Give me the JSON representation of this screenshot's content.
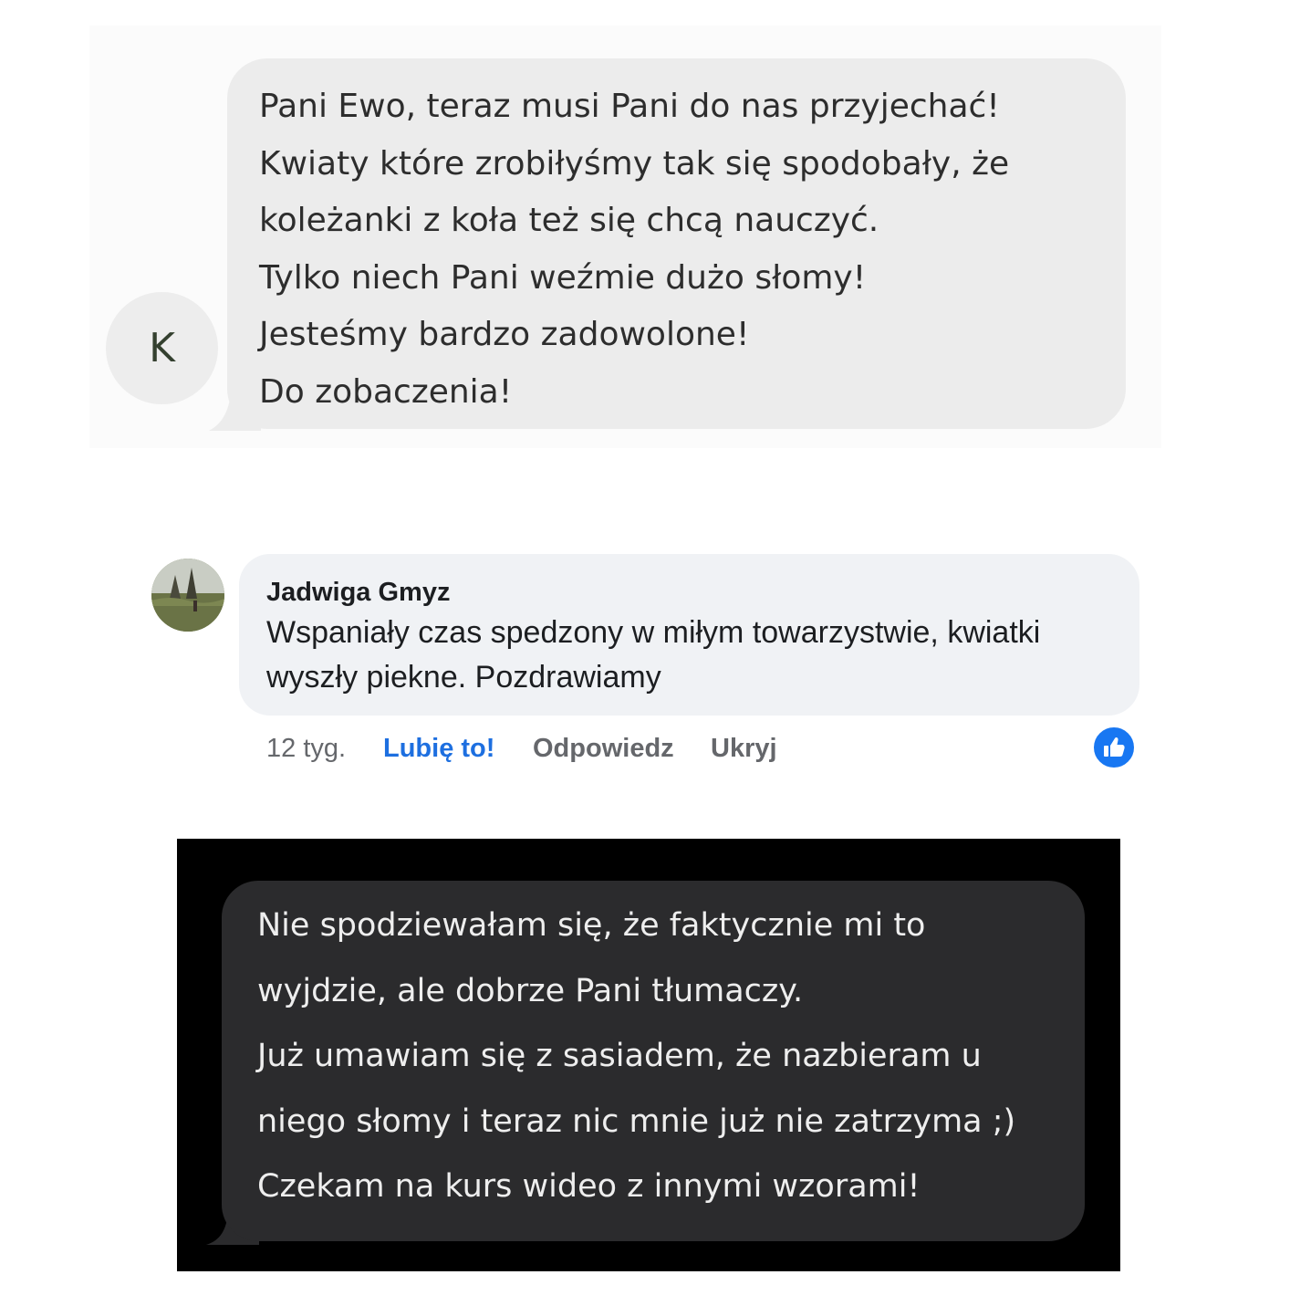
{
  "message1": {
    "avatar_initial": "K",
    "lines": [
      "Pani Ewo, teraz musi Pani do nas przyjechać!",
      "Kwiaty które zrobiłyśmy tak się spodobały, że",
      "koleżanki z koła też się chcą nauczyć.",
      "Tylko niech Pani weźmie dużo słomy!",
      "Jesteśmy bardzo zadowolone!",
      "Do zobaczenia!"
    ],
    "colors": {
      "bubble": "#ececec",
      "text": "#2d2d2d",
      "avatar": "#ededed"
    }
  },
  "comment": {
    "author": "Jadwiga Gmyz",
    "text": "Wspaniały czas spedzony w miłym towarzystwie, kwiatki wyszły piekne. Pozdrawiamy",
    "time": "12 tyg.",
    "like_label": "Lubię to!",
    "reply_label": "Odpowiedz",
    "hide_label": "Ukryj",
    "reaction_icon": "like-reaction-icon",
    "colors": {
      "bubble": "#f0f2f5",
      "accent": "#1877f2"
    }
  },
  "message2": {
    "lines": [
      "Nie spodziewałam się, że faktycznie mi to",
      "wyjdzie, ale dobrze Pani tłumaczy.",
      "Już umawiam się z sasiadem, że nazbieram u",
      "niego słomy i teraz nic mnie już nie zatrzyma ;)",
      "Czekam na kurs wideo z innymi wzorami!"
    ],
    "colors": {
      "background": "#000000",
      "bubble": "#2b2b2d",
      "text": "#eeeeee"
    }
  }
}
